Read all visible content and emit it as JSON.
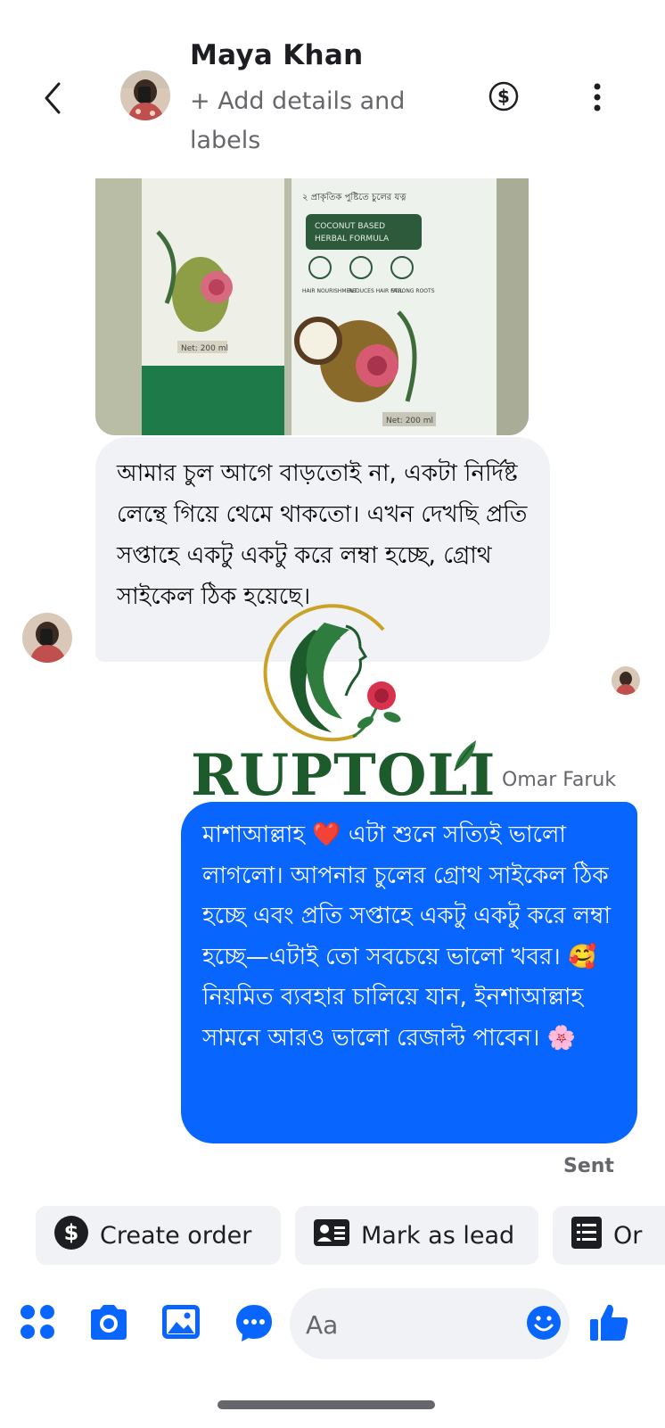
{
  "header": {
    "contact_name": "Maya Khan",
    "add_details": "+ Add details and labels"
  },
  "messages": {
    "incoming_text": "আমার চুল আগে বাড়তোই না, একটা নির্দিষ্ট লেন্থে গিয়ে থেমে থাকতো। এখন দেখছি প্রতি সপ্তাহে একটু একটু করে লম্বা হচ্ছে, গ্রোথ সাইকেল ঠিক হয়েছে।",
    "outgoing_sender": "Omar Faruk",
    "outgoing_text": "মাশাআল্লাহ ❤️ এটা শুনে সত্যিই ভালো লাগলো। আপনার চুলের গ্রোথ সাইকেল ঠিক হচ্ছে এবং প্রতি সপ্তাহে একটু একটু করে লম্বা হচ্ছে—এটাই তো সবচেয়ে ভালো খবর। 🥰 নিয়মিত ব্যবহার চালিয়ে যান, ইনশাআল্লাহ সামনে আরও ভালো রেজাল্ট পাবেন। 🌸",
    "status": "Sent"
  },
  "product_photo": {
    "bottle_banner": "২ প্রাকৃতিক পুষ্টিতে চুলের যত্ন",
    "formula_line1": "COCONUT BASED",
    "formula_line2": "HERBAL FORMULA",
    "icon_labels": [
      "HAIR NOURISHMENT",
      "REDUCES HAIR FALL",
      "STRONG ROOTS"
    ],
    "net_volume": "Net: 200 ml"
  },
  "watermark": {
    "brand": "RUPTOLI"
  },
  "actions": [
    {
      "label": "Create order",
      "icon": "dollar-circle-icon"
    },
    {
      "label": "Mark as lead",
      "icon": "contact-card-icon"
    },
    {
      "label": "Or",
      "icon": "order-list-icon"
    }
  ],
  "composer": {
    "placeholder": "Aa"
  },
  "colors": {
    "accent": "#0866ff",
    "incoming_bubble": "#f0f2f5",
    "brand_green": "#1d5b2c",
    "brand_gold": "#c9a227"
  }
}
